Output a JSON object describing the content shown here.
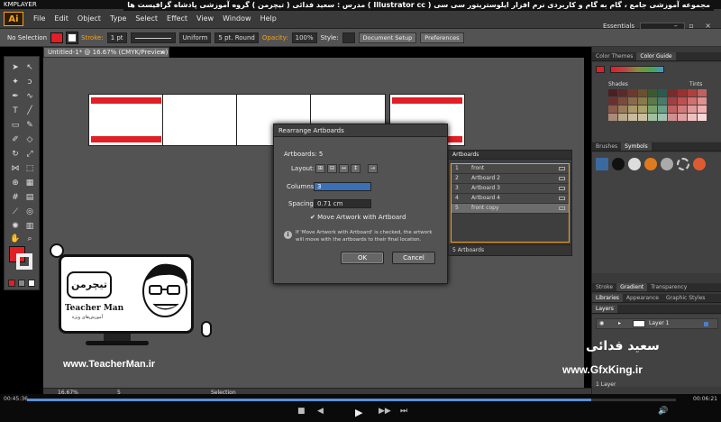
{
  "player": {
    "brand": "KMPLAYER",
    "window_controls": "▪ ▫ ×",
    "time_elapsed": "00:45:36",
    "time_total": "00:06:21",
    "progress": 0.87,
    "controls": [
      "■",
      "◀",
      "▶",
      "▶▶",
      "⏭",
      "🔊"
    ]
  },
  "title_overlay": "مجموعه آموزشی جامع ، گام به گام و کاربردی نرم افزار ایلوستریتور سی سی ( Illustrator cc ) مدرس : سعید فدائی ( تیچرمن ) گروه آموزشی پادشاه گرافیست ها",
  "app": {
    "logo": "Ai",
    "menu": [
      "File",
      "Edit",
      "Object",
      "Type",
      "Select",
      "Effect",
      "View",
      "Window",
      "Help"
    ],
    "workspace": "Essentials",
    "window_controls": "– ▫ ×"
  },
  "control_bar": {
    "selection_label": "No Selection",
    "stroke_label": "Stroke:",
    "stroke_value": "1 pt",
    "line_style": "Uniform",
    "brush": "5 pt. Round",
    "opacity_label": "Opacity:",
    "opacity_value": "100%",
    "style_label": "Style:",
    "doc_setup": "Document Setup",
    "preferences": "Preferences"
  },
  "document": {
    "tab_title": "Untitled-1* @ 16.67% (CMYK/Preview)",
    "artboards": [
      {
        "id": "front",
        "bars": true
      },
      {
        "id": "ab2",
        "bars": false
      },
      {
        "id": "ab3",
        "bars": false
      },
      {
        "id": "ab4",
        "bars": false
      },
      {
        "id": "front-copy",
        "bars": true
      }
    ]
  },
  "dialog": {
    "title": "Rearrange Artboards",
    "artboards_label": "Artboards: 5",
    "layout_label": "Layout:",
    "columns_label": "Columns:",
    "columns_value": "3",
    "spacing_label": "Spacing:",
    "spacing_value": "0.71 cm",
    "move_artwork": "Move Artwork with Artboard",
    "info": "If 'Move Artwork with Artboard' is checked, the artwork will move with the artboards to their final location.",
    "ok": "OK",
    "cancel": "Cancel"
  },
  "artboards_panel": {
    "tab": "Artboards",
    "rows": [
      {
        "num": "1",
        "name": "front"
      },
      {
        "num": "2",
        "name": "Artboard 2"
      },
      {
        "num": "3",
        "name": "Artboard 3"
      },
      {
        "num": "4",
        "name": "Artboard 4"
      },
      {
        "num": "5",
        "name": "front copy"
      }
    ],
    "footer": "5 Artboards"
  },
  "right_panels": {
    "color_tabs": [
      "Color Themes",
      "Color Guide"
    ],
    "shades_label": "Shades",
    "tints_label": "Tints",
    "brush_tabs": [
      "Brushes",
      "Symbols"
    ],
    "stroke_tabs": [
      "Stroke",
      "Gradient",
      "Transparency"
    ],
    "lib_tabs": [
      "Libraries",
      "Appearance",
      "Graphic Styles"
    ],
    "layers_tab": "Layers",
    "layer_name": "Layer 1",
    "layers_footer": "1 Layer"
  },
  "statusbar": {
    "zoom": "16.67%",
    "page": "5",
    "tool": "Selection"
  },
  "overlays": {
    "teacherman_logo_text": "تیچرمن",
    "teacherman_label": "Teacher Man",
    "teacherman_sub": "آموزش‌های ویژه",
    "teacherman_url": "www.TeacherMan.ir",
    "gfxking_url": "www.GfxKing.ir",
    "persian_name": "سعید فدائی"
  },
  "colors": {
    "accent_red": "#e21e26",
    "ai_orange": "#f7a21b",
    "panel_bg": "#535353"
  }
}
